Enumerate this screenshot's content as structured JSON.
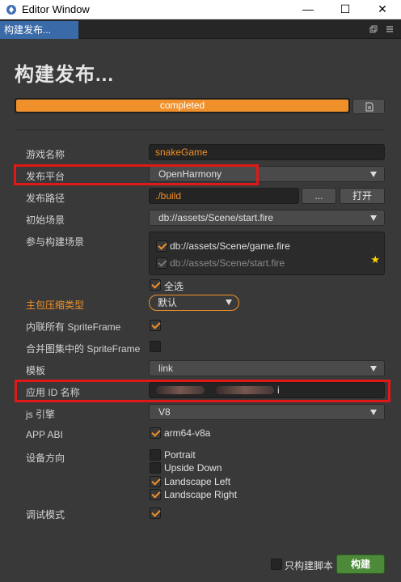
{
  "window": {
    "title": "Editor Window",
    "minimize_glyph": "—",
    "maximize_glyph": "☐",
    "close_glyph": "✕"
  },
  "tab": {
    "label": "构建发布..."
  },
  "page": {
    "title": "构建发布..."
  },
  "progress": {
    "text": "completed",
    "percent": 100
  },
  "fields": {
    "game_name": {
      "label": "游戏名称",
      "value": "snakeGame"
    },
    "platform": {
      "label": "发布平台",
      "value": "OpenHarmony"
    },
    "build_path": {
      "label": "发布路径",
      "value": "./build",
      "browse_label": "...",
      "open_label": "打开"
    },
    "start_scene": {
      "label": "初始场景",
      "value": "db://assets/Scene/start.fire"
    },
    "scenes": {
      "label": "参与构建场景",
      "items": [
        {
          "path": "db://assets/Scene/game.fire",
          "checked": true
        },
        {
          "path": "db://assets/Scene/start.fire",
          "checked": true
        }
      ],
      "select_all_label": "全选"
    },
    "compression": {
      "label": "主包压缩类型",
      "value": "默认"
    },
    "inline_spriteframe": {
      "label": "内联所有 SpriteFrame",
      "checked": true
    },
    "merge_spriteframe": {
      "label": "合并图集中的 SpriteFrame",
      "checked": false
    },
    "template": {
      "label": "模板",
      "value": "link"
    },
    "app_id": {
      "label": "应用 ID 名称",
      "value": "i"
    },
    "js_engine": {
      "label": "js 引擎",
      "value": "V8"
    },
    "app_abi": {
      "label": "APP ABI",
      "option": "arm64-v8a",
      "checked": true
    },
    "orientation": {
      "label": "设备方向",
      "options": [
        {
          "label": "Portrait",
          "checked": false
        },
        {
          "label": "Upside Down",
          "checked": false
        },
        {
          "label": "Landscape Left",
          "checked": true
        },
        {
          "label": "Landscape Right",
          "checked": true
        }
      ]
    },
    "debug": {
      "label": "调试模式",
      "checked": true
    }
  },
  "footer": {
    "script_only_label": "只构建脚本",
    "script_only_checked": false,
    "build_label": "构建"
  },
  "colors": {
    "accent": "#f0902a",
    "highlight_box": "#e01818",
    "build_button": "#4c8a3a",
    "tab_active": "#3a6aa8"
  }
}
